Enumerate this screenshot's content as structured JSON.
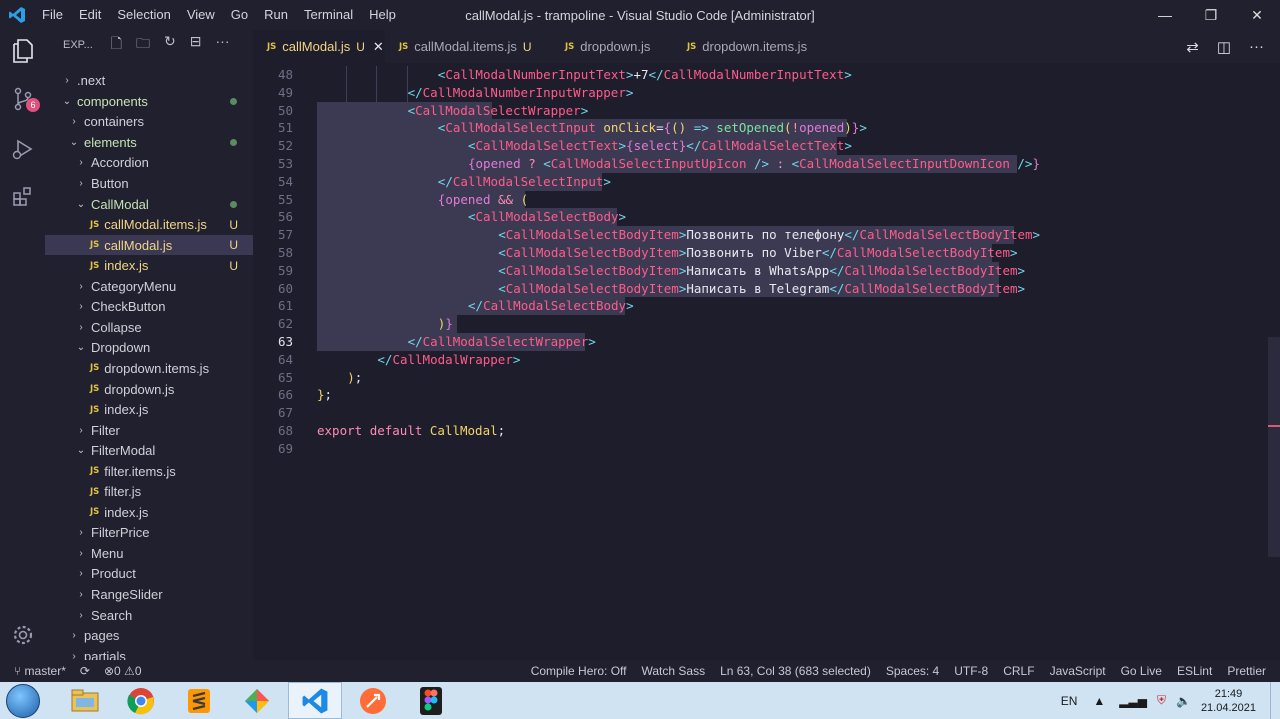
{
  "window": {
    "title": "callModal.js - trampoline - Visual Studio Code [Administrator]",
    "menu": [
      "File",
      "Edit",
      "Selection",
      "View",
      "Go",
      "Run",
      "Terminal",
      "Help"
    ],
    "controls": [
      "—",
      "❐",
      "✕"
    ]
  },
  "activity": {
    "scm_badge": "6"
  },
  "sidebar": {
    "header": "EXP...",
    "items": [
      {
        "label": ".next",
        "indent": 0,
        "chev": "›"
      },
      {
        "label": "components",
        "indent": 0,
        "chev": "⌄",
        "dot": true,
        "green": true
      },
      {
        "label": "containers",
        "indent": 1,
        "chev": "›"
      },
      {
        "label": "elements",
        "indent": 1,
        "chev": "⌄",
        "dot": true,
        "green": true
      },
      {
        "label": "Accordion",
        "indent": 2,
        "chev": "›"
      },
      {
        "label": "Button",
        "indent": 2,
        "chev": "›"
      },
      {
        "label": "CallModal",
        "indent": 2,
        "chev": "⌄",
        "dot": true,
        "green": true
      },
      {
        "label": "callModal.items.js",
        "indent": 3,
        "js": true,
        "u": "U",
        "mod": true
      },
      {
        "label": "callModal.js",
        "indent": 3,
        "js": true,
        "u": "U",
        "mod": true,
        "selected": true
      },
      {
        "label": "index.js",
        "indent": 3,
        "js": true,
        "u": "U",
        "mod": true
      },
      {
        "label": "CategoryMenu",
        "indent": 2,
        "chev": "›"
      },
      {
        "label": "CheckButton",
        "indent": 2,
        "chev": "›"
      },
      {
        "label": "Collapse",
        "indent": 2,
        "chev": "›"
      },
      {
        "label": "Dropdown",
        "indent": 2,
        "chev": "⌄"
      },
      {
        "label": "dropdown.items.js",
        "indent": 3,
        "js": true
      },
      {
        "label": "dropdown.js",
        "indent": 3,
        "js": true
      },
      {
        "label": "index.js",
        "indent": 3,
        "js": true
      },
      {
        "label": "Filter",
        "indent": 2,
        "chev": "›"
      },
      {
        "label": "FilterModal",
        "indent": 2,
        "chev": "⌄"
      },
      {
        "label": "filter.items.js",
        "indent": 3,
        "js": true
      },
      {
        "label": "filter.js",
        "indent": 3,
        "js": true
      },
      {
        "label": "index.js",
        "indent": 3,
        "js": true
      },
      {
        "label": "FilterPrice",
        "indent": 2,
        "chev": "›"
      },
      {
        "label": "Menu",
        "indent": 2,
        "chev": "›"
      },
      {
        "label": "Product",
        "indent": 2,
        "chev": "›"
      },
      {
        "label": "RangeSlider",
        "indent": 2,
        "chev": "›"
      },
      {
        "label": "Search",
        "indent": 2,
        "chev": "›"
      },
      {
        "label": "pages",
        "indent": 1,
        "chev": "›"
      },
      {
        "label": "partials",
        "indent": 1,
        "chev": "›"
      }
    ]
  },
  "tabs": [
    {
      "label": "callModal.js",
      "u": "U",
      "active": true,
      "close": "✕"
    },
    {
      "label": "callModal.items.js",
      "u": "U"
    },
    {
      "label": "dropdown.js"
    },
    {
      "label": "dropdown.items.js"
    }
  ],
  "editor": {
    "current_line": 63,
    "lines": [
      {
        "n": 48,
        "ind": 4,
        "hl": false,
        "tokens": [
          [
            "<",
            "br"
          ],
          [
            "CallModalNumberInputText",
            "tag"
          ],
          [
            ">",
            "br"
          ],
          [
            "+7",
            "txt"
          ],
          [
            "</",
            "br"
          ],
          [
            "CallModalNumberInputText",
            "tag"
          ],
          [
            ">",
            "br"
          ]
        ]
      },
      {
        "n": 49,
        "ind": 3,
        "hl": false,
        "tokens": [
          [
            "</",
            "br"
          ],
          [
            "CallModalNumberInputWrapper",
            "tag"
          ],
          [
            ">",
            "br"
          ]
        ]
      },
      {
        "n": 50,
        "ind": 3,
        "hl": true,
        "hlw": 175,
        "tokens": [
          [
            "<",
            "br"
          ],
          [
            "CallModalSelectWrapper",
            "tag"
          ],
          [
            ">",
            "br"
          ]
        ]
      },
      {
        "n": 51,
        "ind": 4,
        "hl": true,
        "hlw": 530,
        "tokens": [
          [
            "<",
            "br"
          ],
          [
            "CallModalSelectInput",
            "tag"
          ],
          [
            " ",
            "plain"
          ],
          [
            "onClick",
            "attr"
          ],
          [
            "=",
            "plain"
          ],
          [
            "{",
            "var"
          ],
          [
            "()",
            "attr"
          ],
          [
            " => ",
            "br"
          ],
          [
            "setOpened",
            "fn"
          ],
          [
            "(",
            "attr"
          ],
          [
            "!",
            "kw"
          ],
          [
            "opened",
            "var"
          ],
          [
            ")",
            "attr"
          ],
          [
            "}",
            "var"
          ],
          [
            ">",
            "br"
          ]
        ]
      },
      {
        "n": 52,
        "ind": 5,
        "hl": true,
        "hlw": 520,
        "tokens": [
          [
            "<",
            "br"
          ],
          [
            "CallModalSelectText",
            "tag"
          ],
          [
            ">",
            "br"
          ],
          [
            "{",
            "var"
          ],
          [
            "select",
            "var"
          ],
          [
            "}",
            "var"
          ],
          [
            "</",
            "br"
          ],
          [
            "CallModalSelectText",
            "tag"
          ],
          [
            ">",
            "br"
          ]
        ]
      },
      {
        "n": 53,
        "ind": 5,
        "hl": true,
        "hlw": 700,
        "tokens": [
          [
            "{",
            "var"
          ],
          [
            "opened",
            "var"
          ],
          [
            " ? ",
            "kw"
          ],
          [
            "<",
            "br"
          ],
          [
            "CallModalSelectInputUpIcon",
            "tag"
          ],
          [
            " />",
            "br"
          ],
          [
            " : ",
            "kw"
          ],
          [
            "<",
            "br"
          ],
          [
            "CallModalSelectInputDownIcon",
            "tag"
          ],
          [
            " />",
            "br"
          ],
          [
            "}",
            "var"
          ]
        ]
      },
      {
        "n": 54,
        "ind": 4,
        "hl": true,
        "hlw": 285,
        "tokens": [
          [
            "</",
            "br"
          ],
          [
            "CallModalSelectInput",
            "tag"
          ],
          [
            ">",
            "br"
          ]
        ]
      },
      {
        "n": 55,
        "ind": 4,
        "hl": true,
        "hlw": 208,
        "tokens": [
          [
            "{",
            "var"
          ],
          [
            "opened",
            "var"
          ],
          [
            " && ",
            "kw"
          ],
          [
            "(",
            "attr"
          ]
        ]
      },
      {
        "n": 56,
        "ind": 5,
        "hl": true,
        "hlw": 300,
        "tokens": [
          [
            "<",
            "br"
          ],
          [
            "CallModalSelectBody",
            "tag"
          ],
          [
            ">",
            "br"
          ]
        ]
      },
      {
        "n": 57,
        "ind": 6,
        "hl": true,
        "hlw": 697,
        "tokens": [
          [
            "<",
            "br"
          ],
          [
            "CallModalSelectBodyItem",
            "tag"
          ],
          [
            ">",
            "br"
          ],
          [
            "Позвонить по телефону",
            "txt"
          ],
          [
            "</",
            "br"
          ],
          [
            "CallModalSelectBodyItem",
            "tag"
          ],
          [
            ">",
            "br"
          ]
        ]
      },
      {
        "n": 58,
        "ind": 6,
        "hl": true,
        "hlw": 675,
        "tokens": [
          [
            "<",
            "br"
          ],
          [
            "CallModalSelectBodyItem",
            "tag"
          ],
          [
            ">",
            "br"
          ],
          [
            "Позвонить по Viber",
            "txt"
          ],
          [
            "</",
            "br"
          ],
          [
            "CallModalSelectBodyItem",
            "tag"
          ],
          [
            ">",
            "br"
          ]
        ]
      },
      {
        "n": 59,
        "ind": 6,
        "hl": true,
        "hlw": 682,
        "tokens": [
          [
            "<",
            "br"
          ],
          [
            "CallModalSelectBodyItem",
            "tag"
          ],
          [
            ">",
            "br"
          ],
          [
            "Написать в WhatsApp",
            "txt"
          ],
          [
            "</",
            "br"
          ],
          [
            "CallModalSelectBodyItem",
            "tag"
          ],
          [
            ">",
            "br"
          ]
        ]
      },
      {
        "n": 60,
        "ind": 6,
        "hl": true,
        "hlw": 682,
        "tokens": [
          [
            "<",
            "br"
          ],
          [
            "CallModalSelectBodyItem",
            "tag"
          ],
          [
            ">",
            "br"
          ],
          [
            "Написать в Telegram",
            "txt"
          ],
          [
            "</",
            "br"
          ],
          [
            "CallModalSelectBodyItem",
            "tag"
          ],
          [
            ">",
            "br"
          ]
        ]
      },
      {
        "n": 61,
        "ind": 5,
        "hl": true,
        "hlw": 308,
        "tokens": [
          [
            "</",
            "br"
          ],
          [
            "CallModalSelectBody",
            "tag"
          ],
          [
            ">",
            "br"
          ]
        ]
      },
      {
        "n": 62,
        "ind": 4,
        "hl": true,
        "hlw": 140,
        "tokens": [
          [
            ")",
            "attr"
          ],
          [
            "}",
            "var"
          ]
        ]
      },
      {
        "n": 63,
        "ind": 3,
        "hl": true,
        "hlw": 268,
        "tokens": [
          [
            "</",
            "br"
          ],
          [
            "CallModalSelectWrapper",
            "tag"
          ],
          [
            ">",
            "br"
          ]
        ]
      },
      {
        "n": 64,
        "ind": 2,
        "hl": false,
        "tokens": [
          [
            "</",
            "br"
          ],
          [
            "CallModalWrapper",
            "tag"
          ],
          [
            ">",
            "br"
          ]
        ]
      },
      {
        "n": 65,
        "ind": 1,
        "hl": false,
        "tokens": [
          [
            ")",
            "attr"
          ],
          [
            ";",
            "plain"
          ]
        ]
      },
      {
        "n": 66,
        "ind": 0,
        "hl": false,
        "tokens": [
          [
            "}",
            "cls"
          ],
          [
            ";",
            "plain"
          ]
        ]
      },
      {
        "n": 67,
        "ind": 0,
        "hl": false,
        "tokens": []
      },
      {
        "n": 68,
        "ind": 0,
        "hl": false,
        "tokens": [
          [
            "export",
            "kw"
          ],
          [
            " ",
            "plain"
          ],
          [
            "default",
            "kw"
          ],
          [
            " ",
            "plain"
          ],
          [
            "CallModal",
            "cls"
          ],
          [
            ";",
            "plain"
          ]
        ]
      },
      {
        "n": 69,
        "ind": 0,
        "hl": false,
        "tokens": []
      }
    ]
  },
  "status": {
    "branch": "master*",
    "sync": "⟳",
    "errors": "0",
    "warnings": "0",
    "right": [
      "Compile Hero: Off",
      "Watch Sass",
      "Ln 63, Col 38 (683 selected)",
      "Spaces: 4",
      "UTF-8",
      "CRLF",
      "JavaScript",
      "Go Live",
      "ESLint",
      "Prettier"
    ]
  },
  "taskbar": {
    "lang": "EN",
    "time": "21:49",
    "date": "21.04.2021"
  },
  "colors": {
    "accent": "#f1d585",
    "tag": "#ff5c8a",
    "bracket": "#74d7ec"
  }
}
